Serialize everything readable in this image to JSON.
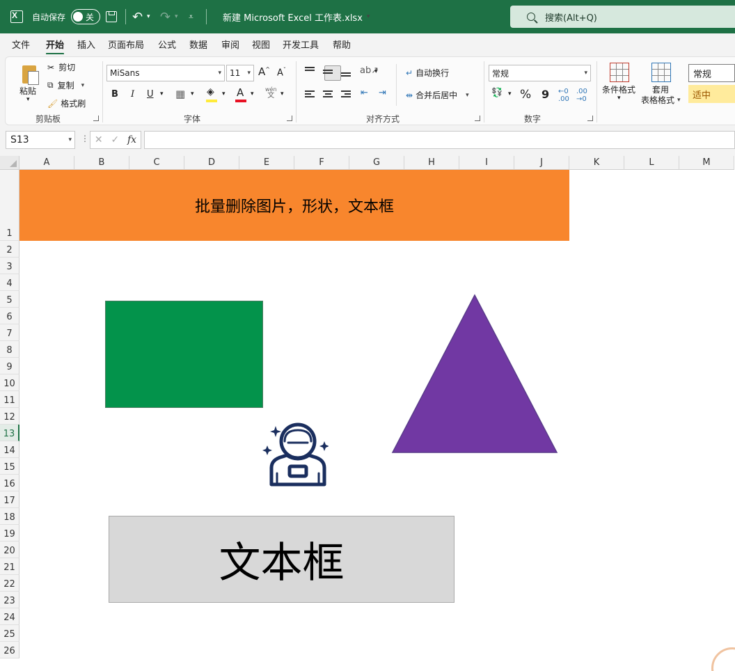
{
  "titlebar": {
    "autosave_label": "自动保存",
    "autosave_state": "关",
    "doc_title": "新建 Microsoft Excel 工作表.xlsx",
    "search_placeholder": "搜索(Alt+Q)",
    "accent_color": "#1e7145"
  },
  "menu": {
    "tabs": [
      "文件",
      "开始",
      "插入",
      "页面布局",
      "公式",
      "数据",
      "审阅",
      "视图",
      "开发工具",
      "帮助"
    ],
    "active": "开始"
  },
  "ribbon": {
    "clipboard": {
      "paste": "粘贴",
      "cut": "剪切",
      "copy": "复制",
      "format_painter": "格式刷",
      "label": "剪贴板"
    },
    "font": {
      "name": "MiSans",
      "size": "11",
      "bold": "B",
      "italic": "I",
      "underline": "U",
      "grow": "A",
      "shrink": "A",
      "phonetic_top": "wén",
      "phonetic_bottom": "文",
      "label": "字体"
    },
    "alignment": {
      "wrap_text": "自动换行",
      "merge_center": "合并后居中",
      "label": "对齐方式"
    },
    "number": {
      "format": "常规",
      "percent": "%",
      "comma": "9",
      "label": "数字"
    },
    "styles": {
      "conditional": "条件格式",
      "table_top": "套用",
      "table_bottom": "表格格式",
      "normal": "常规",
      "neutral": "适中"
    }
  },
  "formula_bar": {
    "name_box": "S13",
    "fx": "fx",
    "formula": ""
  },
  "sheet": {
    "columns": [
      "A",
      "B",
      "C",
      "D",
      "E",
      "F",
      "G",
      "H",
      "I",
      "J",
      "K",
      "L",
      "M"
    ],
    "rows": [
      "1",
      "2",
      "3",
      "4",
      "5",
      "6",
      "7",
      "8",
      "9",
      "10",
      "11",
      "12",
      "13",
      "14",
      "15",
      "16",
      "17",
      "18",
      "19",
      "20",
      "21",
      "22",
      "23",
      "24",
      "25",
      "26"
    ],
    "selected_row": "13",
    "banner_text": "批量删除图片，形状，文本框",
    "textbox_text": "文本框",
    "colors": {
      "banner": "#f8862d",
      "rectangle": "#03934b",
      "triangle": "#7138a3",
      "textbox": "#d8d8d8",
      "astronaut": "#1a2e5e"
    }
  }
}
